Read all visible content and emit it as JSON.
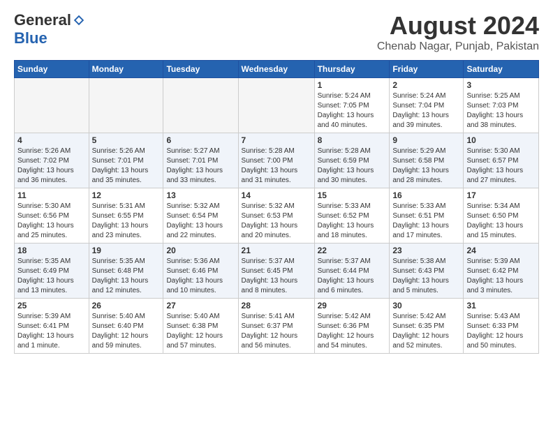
{
  "header": {
    "logo_general": "General",
    "logo_blue": "Blue",
    "month_title": "August 2024",
    "location": "Chenab Nagar, Punjab, Pakistan"
  },
  "days_of_week": [
    "Sunday",
    "Monday",
    "Tuesday",
    "Wednesday",
    "Thursday",
    "Friday",
    "Saturday"
  ],
  "weeks": [
    [
      {
        "day": "",
        "info": ""
      },
      {
        "day": "",
        "info": ""
      },
      {
        "day": "",
        "info": ""
      },
      {
        "day": "",
        "info": ""
      },
      {
        "day": "1",
        "info": "Sunrise: 5:24 AM\nSunset: 7:05 PM\nDaylight: 13 hours\nand 40 minutes."
      },
      {
        "day": "2",
        "info": "Sunrise: 5:24 AM\nSunset: 7:04 PM\nDaylight: 13 hours\nand 39 minutes."
      },
      {
        "day": "3",
        "info": "Sunrise: 5:25 AM\nSunset: 7:03 PM\nDaylight: 13 hours\nand 38 minutes."
      }
    ],
    [
      {
        "day": "4",
        "info": "Sunrise: 5:26 AM\nSunset: 7:02 PM\nDaylight: 13 hours\nand 36 minutes."
      },
      {
        "day": "5",
        "info": "Sunrise: 5:26 AM\nSunset: 7:01 PM\nDaylight: 13 hours\nand 35 minutes."
      },
      {
        "day": "6",
        "info": "Sunrise: 5:27 AM\nSunset: 7:01 PM\nDaylight: 13 hours\nand 33 minutes."
      },
      {
        "day": "7",
        "info": "Sunrise: 5:28 AM\nSunset: 7:00 PM\nDaylight: 13 hours\nand 31 minutes."
      },
      {
        "day": "8",
        "info": "Sunrise: 5:28 AM\nSunset: 6:59 PM\nDaylight: 13 hours\nand 30 minutes."
      },
      {
        "day": "9",
        "info": "Sunrise: 5:29 AM\nSunset: 6:58 PM\nDaylight: 13 hours\nand 28 minutes."
      },
      {
        "day": "10",
        "info": "Sunrise: 5:30 AM\nSunset: 6:57 PM\nDaylight: 13 hours\nand 27 minutes."
      }
    ],
    [
      {
        "day": "11",
        "info": "Sunrise: 5:30 AM\nSunset: 6:56 PM\nDaylight: 13 hours\nand 25 minutes."
      },
      {
        "day": "12",
        "info": "Sunrise: 5:31 AM\nSunset: 6:55 PM\nDaylight: 13 hours\nand 23 minutes."
      },
      {
        "day": "13",
        "info": "Sunrise: 5:32 AM\nSunset: 6:54 PM\nDaylight: 13 hours\nand 22 minutes."
      },
      {
        "day": "14",
        "info": "Sunrise: 5:32 AM\nSunset: 6:53 PM\nDaylight: 13 hours\nand 20 minutes."
      },
      {
        "day": "15",
        "info": "Sunrise: 5:33 AM\nSunset: 6:52 PM\nDaylight: 13 hours\nand 18 minutes."
      },
      {
        "day": "16",
        "info": "Sunrise: 5:33 AM\nSunset: 6:51 PM\nDaylight: 13 hours\nand 17 minutes."
      },
      {
        "day": "17",
        "info": "Sunrise: 5:34 AM\nSunset: 6:50 PM\nDaylight: 13 hours\nand 15 minutes."
      }
    ],
    [
      {
        "day": "18",
        "info": "Sunrise: 5:35 AM\nSunset: 6:49 PM\nDaylight: 13 hours\nand 13 minutes."
      },
      {
        "day": "19",
        "info": "Sunrise: 5:35 AM\nSunset: 6:48 PM\nDaylight: 13 hours\nand 12 minutes."
      },
      {
        "day": "20",
        "info": "Sunrise: 5:36 AM\nSunset: 6:46 PM\nDaylight: 13 hours\nand 10 minutes."
      },
      {
        "day": "21",
        "info": "Sunrise: 5:37 AM\nSunset: 6:45 PM\nDaylight: 13 hours\nand 8 minutes."
      },
      {
        "day": "22",
        "info": "Sunrise: 5:37 AM\nSunset: 6:44 PM\nDaylight: 13 hours\nand 6 minutes."
      },
      {
        "day": "23",
        "info": "Sunrise: 5:38 AM\nSunset: 6:43 PM\nDaylight: 13 hours\nand 5 minutes."
      },
      {
        "day": "24",
        "info": "Sunrise: 5:39 AM\nSunset: 6:42 PM\nDaylight: 13 hours\nand 3 minutes."
      }
    ],
    [
      {
        "day": "25",
        "info": "Sunrise: 5:39 AM\nSunset: 6:41 PM\nDaylight: 13 hours\nand 1 minute."
      },
      {
        "day": "26",
        "info": "Sunrise: 5:40 AM\nSunset: 6:40 PM\nDaylight: 12 hours\nand 59 minutes."
      },
      {
        "day": "27",
        "info": "Sunrise: 5:40 AM\nSunset: 6:38 PM\nDaylight: 12 hours\nand 57 minutes."
      },
      {
        "day": "28",
        "info": "Sunrise: 5:41 AM\nSunset: 6:37 PM\nDaylight: 12 hours\nand 56 minutes."
      },
      {
        "day": "29",
        "info": "Sunrise: 5:42 AM\nSunset: 6:36 PM\nDaylight: 12 hours\nand 54 minutes."
      },
      {
        "day": "30",
        "info": "Sunrise: 5:42 AM\nSunset: 6:35 PM\nDaylight: 12 hours\nand 52 minutes."
      },
      {
        "day": "31",
        "info": "Sunrise: 5:43 AM\nSunset: 6:33 PM\nDaylight: 12 hours\nand 50 minutes."
      }
    ]
  ]
}
